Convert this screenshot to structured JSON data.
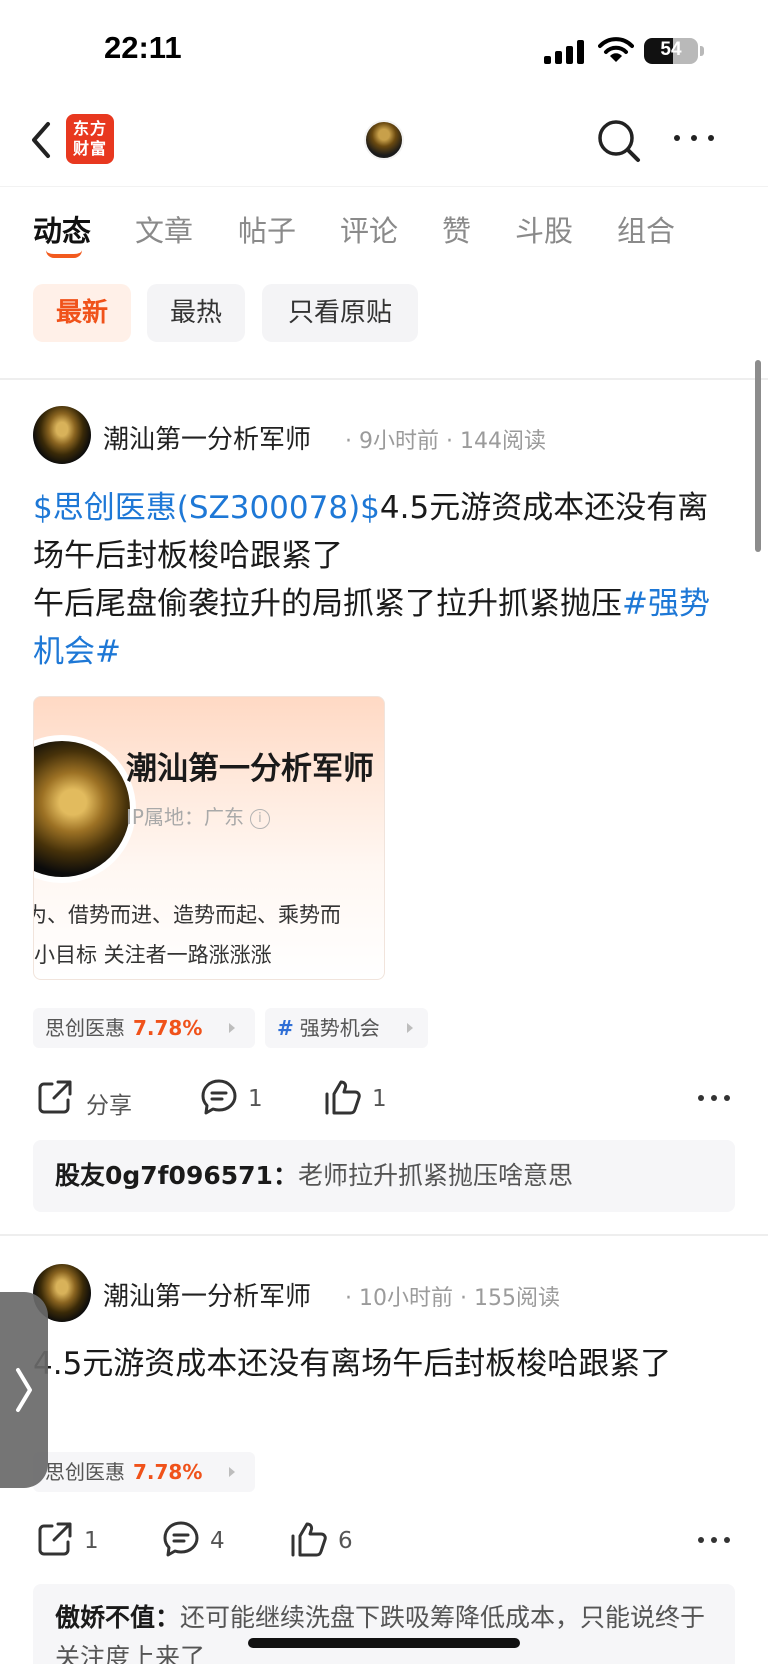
{
  "status_bar": {
    "time": "22:11",
    "battery": "54",
    "battery_level": 0.54
  },
  "header": {
    "logo_text": "东方财富",
    "avatar_icon": "user-avatar"
  },
  "tabs": [
    {
      "label": "动态",
      "active": true
    },
    {
      "label": "文章"
    },
    {
      "label": "帖子"
    },
    {
      "label": "评论"
    },
    {
      "label": "赞"
    },
    {
      "label": "斗股"
    },
    {
      "label": "组合"
    }
  ],
  "filters": [
    {
      "label": "最新",
      "active": true
    },
    {
      "label": "最热"
    },
    {
      "label": "只看原贴"
    }
  ],
  "posts": [
    {
      "author": "潮汕第一分析军师",
      "time": "9小时前",
      "reads": "144阅读",
      "stock_link": "$思创医惠(SZ300078)$",
      "text1": "4.5元游资成本还没有离场午后封板梭哈跟紧了",
      "text2": "午后尾盘偷袭拉升的局抓紧了拉升抓紧抛压",
      "topic_link": "#强势机会#",
      "image": {
        "name": "潮汕第一分析军师",
        "ip_label": "IP属地：",
        "ip_value": "广东",
        "info_icon": "i",
        "bio_line1": "为、借势而进、造势而起、乘势而",
        "bio_line2": "小目标 关注者一路涨涨涨"
      },
      "stock_tag": {
        "name": "思创医惠",
        "change": "7.78%"
      },
      "topic_tag": {
        "hash": "#",
        "name": "强势机会"
      },
      "actions": {
        "share": "分享",
        "comments": "1",
        "likes": "1"
      },
      "comment": {
        "user": "股友0g7f096571",
        "sep": "：",
        "text": "老师拉升抓紧抛压啥意思"
      }
    },
    {
      "author": "潮汕第一分析军师",
      "time": "10小时前",
      "reads": "155阅读",
      "text1": "4.5元游资成本还没有离场午后封板梭哈跟紧了",
      "stock_tag": {
        "name": "思创医惠",
        "change": "7.78%"
      },
      "actions": {
        "shares": "1",
        "comments": "4",
        "likes": "6"
      },
      "comment": {
        "user": "傲娇不值",
        "sep": "：",
        "text": "还可能继续洗盘下跌吸筹降低成本，只能说终于关注度上来了"
      }
    }
  ],
  "colors": {
    "accent": "#f0521a",
    "link": "#1e78d6",
    "brand": "#e8381f"
  }
}
